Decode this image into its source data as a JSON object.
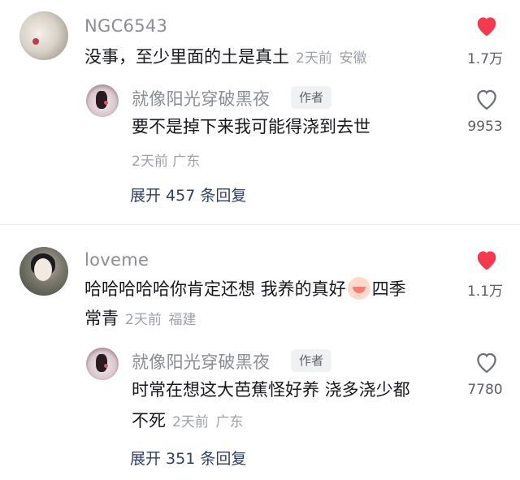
{
  "comments": [
    {
      "username": "NGC6543",
      "text": "没事，至少里面的土是真土",
      "time": "2天前",
      "location": "安徽",
      "like_count": "1.7万",
      "liked": true,
      "reply": {
        "username": "就像阳光穿破黑夜",
        "author_badge": "作者",
        "text": "要不是掉下来我可能得浇到去世",
        "time": "2天前",
        "location": "广东",
        "like_count": "9953",
        "liked": false
      },
      "expand_label": "展开 457 条回复"
    },
    {
      "username": "loveme",
      "text_line1": "哈哈哈哈哈你肯定还想 我养的真好",
      "text_line1_tail": "四季",
      "text_line2": "常青",
      "time": "2天前",
      "location": "福建",
      "like_count": "1.1万",
      "liked": true,
      "reply": {
        "username": "就像阳光穿破黑夜",
        "author_badge": "作者",
        "text_line1": "时常在想这大芭蕉怪好养 浇多浇少都",
        "text_line2": "不死",
        "time": "2天前",
        "location": "广东",
        "like_count": "7780",
        "liked": false
      },
      "expand_label": "展开 351 条回复"
    }
  ],
  "colors": {
    "liked_heart": "#f5394f",
    "unliked_heart": "#6b6f76",
    "expand_text": "#2f3f63"
  },
  "icons": {
    "like": "heart-icon",
    "emoji": "peach-emoji-icon"
  }
}
